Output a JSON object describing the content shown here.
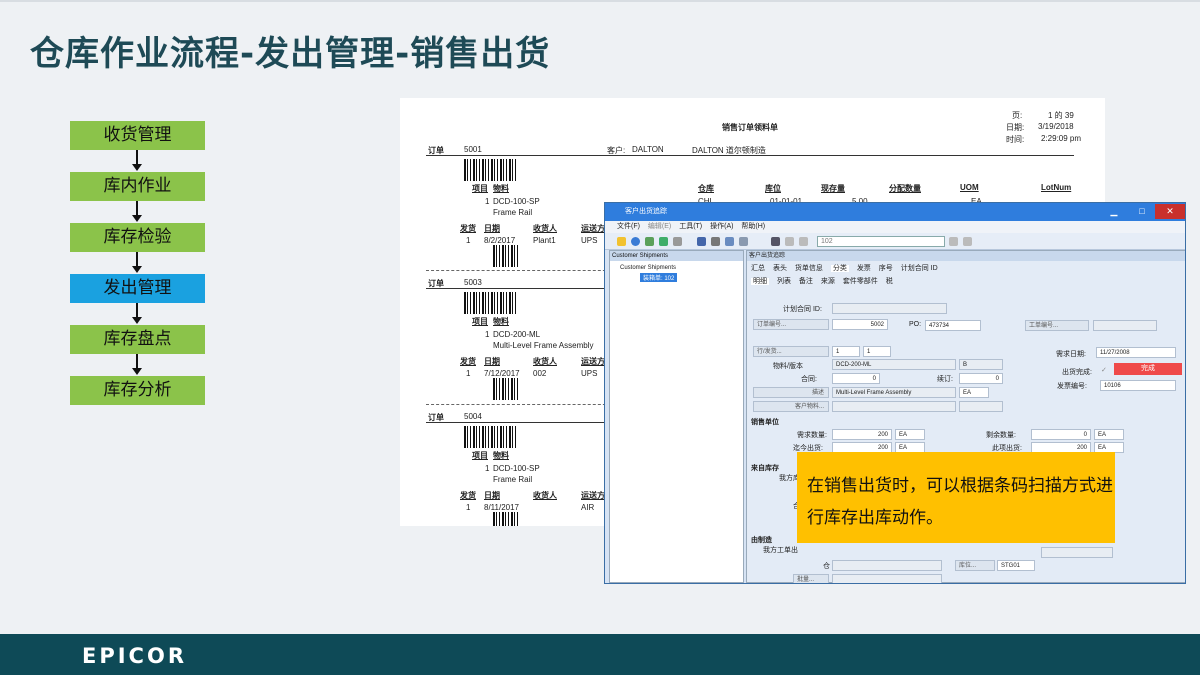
{
  "slide": {
    "title": "仓库作业流程-发出管理-销售出货"
  },
  "flow": {
    "steps": [
      "收货管理",
      "库内作业",
      "库存检验",
      "发出管理",
      "库存盘点",
      "库存分析"
    ],
    "active_index": 3
  },
  "report": {
    "title": "销售订单领料单",
    "page_label": "页:",
    "page_value": "1 的 39",
    "date_label": "日期:",
    "date_value": "3/19/2018",
    "time_label": "时间:",
    "time_value": "2:29:09 pm",
    "order_label": "订单",
    "customer_label": "客户:",
    "customer_code": "DALTON",
    "customer_name": "DALTON 道尔顿制造",
    "cols": {
      "item": "项目",
      "part": "物料",
      "wh": "仓库",
      "bin": "库位",
      "onhand": "现存量",
      "alloc": "分配数量",
      "uom": "UOM",
      "lot": "LotNum"
    },
    "first_row": {
      "wh": "CHI",
      "bin": "01-01-01",
      "onhand": "5.00",
      "uom": "EA"
    },
    "ship_cols": {
      "rel": "发货",
      "date": "日期",
      "recv": "收货人",
      "via": "运送方"
    },
    "orders": [
      {
        "num": "5001",
        "line": "1",
        "part": "DCD-100-SP",
        "desc": "Frame Rail",
        "rel": "1",
        "date": "8/2/2017",
        "recv": "Plant1",
        "via": "UPS"
      },
      {
        "num": "5003",
        "line": "1",
        "part": "DCD-200-ML",
        "desc": "Multi-Level Frame Assembly",
        "rel": "1",
        "date": "7/12/2017",
        "recv": "002",
        "via": "UPS"
      },
      {
        "num": "5004",
        "line": "1",
        "part": "DCD-100-SP",
        "desc": "Frame Rail",
        "rel": "1",
        "date": "8/11/2017",
        "recv": "",
        "via": "AIR"
      }
    ]
  },
  "window": {
    "title": "客户出货追踪",
    "menu": [
      "文件(F)",
      "编辑(E)",
      "工具(T)",
      "操作(A)",
      "帮助(H)"
    ],
    "packing_value": "102",
    "tree_header": "Customer Shipments",
    "tree_root": "Customer Shipments",
    "tree_node": "装箱单: 102",
    "panel_header": "客户出货追踪",
    "tabs": [
      "汇总",
      "表头",
      "货单信息",
      "分类",
      "发票",
      "序号",
      "计划合同 ID"
    ],
    "subtabs": [
      "明细",
      "列表",
      "备注",
      "来源",
      "套件零部件",
      "税"
    ],
    "labels": {
      "contract_id": "计划合同 ID:",
      "order_btn": "订单编号...",
      "po": "PO:",
      "job_btn": "工单编号...",
      "line_btn": "行/发货...",
      "part_rev": "物料/版本",
      "contract": "合同:",
      "revision": "续订:",
      "desc_btn": "描述",
      "cust_part_btn": "客户物料...",
      "need_date": "需求日期:",
      "ship_complete": "出货完成:",
      "invoice_no": "发票编号:",
      "sales_unit": "销售单位",
      "req_qty": "需求数量:",
      "shipped_to_date": "迄今出货:",
      "remaining": "剩余数量:",
      "this_ship": "此项出货:",
      "from_stock": "来自库存",
      "our_stock": "我方库",
      "from_mfg": "由制造",
      "our_job": "我方工单出",
      "bin_btn": "库位...",
      "lot_btn": "批量...",
      "wh_short": "合",
      "warehouse_short": "仓"
    },
    "values": {
      "order": "5002",
      "po": "473734",
      "line": "1",
      "release": "1",
      "part": "DCD-200-ML",
      "rev": "B",
      "contract": "0",
      "revision": "0",
      "desc": "Multi-Level Frame Assembly",
      "desc_uom": "EA",
      "need_date": "11/27/2008",
      "status": "完成",
      "invoice": "10106",
      "req_qty": "200",
      "req_uom": "EA",
      "shipped_qty": "200",
      "shipped_uom": "EA",
      "remaining": "0",
      "remaining_uom": "EA",
      "this_ship": "200",
      "this_uom": "EA",
      "bin": "STG01"
    }
  },
  "callout": {
    "text": "在销售出货时，可以根据条码扫描方式进行库存出库动作。"
  },
  "footer": {
    "logo": "EPICOR"
  },
  "colors": {
    "flow_step": "#8bc34a",
    "flow_active": "#1aa1e0",
    "footer": "#0e4a57",
    "callout": "#ffc000",
    "title": "#1e4a56"
  }
}
